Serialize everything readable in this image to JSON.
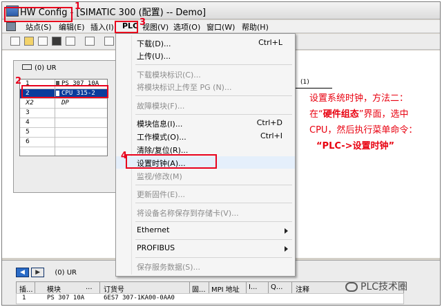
{
  "window": {
    "title": "HW Config - [SIMATIC 300 (配置) -- Demo]"
  },
  "menubar": {
    "items": [
      "站点(S)",
      "编辑(E)",
      "插入(I)",
      "PLC",
      "视图(V)",
      "选项(O)",
      "窗口(W)",
      "帮助(H)"
    ]
  },
  "station": {
    "rack_title": "(0)  UR",
    "rows": [
      {
        "slot": "1",
        "module": "PS 307 10A"
      },
      {
        "slot": "2",
        "module": "CPU 315-2"
      },
      {
        "slot": "X2",
        "module": "DP"
      },
      {
        "slot": "3",
        "module": ""
      },
      {
        "slot": "4",
        "module": ""
      },
      {
        "slot": "5",
        "module": ""
      },
      {
        "slot": "6",
        "module": ""
      }
    ],
    "bus_label": "(1)"
  },
  "plc_menu": {
    "items": [
      {
        "label": "下载(D)...",
        "shortcut": "Ctrl+L",
        "disabled": false
      },
      {
        "label": "上传(U)...",
        "shortcut": "",
        "disabled": false
      },
      {
        "label": "下载模块标识(C)...",
        "shortcut": "",
        "disabled": true
      },
      {
        "label": "将模块标识上传至 PG (N)...",
        "shortcut": "",
        "disabled": true
      },
      {
        "label": "故障模块(F)...",
        "shortcut": "",
        "disabled": true
      },
      {
        "label": "模块信息(I)...",
        "shortcut": "Ctrl+D",
        "disabled": false
      },
      {
        "label": "工作模式(O)...",
        "shortcut": "Ctrl+I",
        "disabled": false
      },
      {
        "label": "清除/复位(R)...",
        "shortcut": "",
        "disabled": false
      },
      {
        "label": "设置时钟(A)...",
        "shortcut": "",
        "disabled": false
      },
      {
        "label": "监视/修改(M)",
        "shortcut": "",
        "disabled": true
      },
      {
        "label": "更新固件(E)...",
        "shortcut": "",
        "disabled": true
      },
      {
        "label": "将设备名称保存到存储卡(V)...",
        "shortcut": "",
        "disabled": true
      },
      {
        "label": "Ethernet",
        "shortcut": "",
        "disabled": false,
        "submenu": true
      },
      {
        "label": "PROFIBUS",
        "shortcut": "",
        "disabled": false,
        "submenu": true
      },
      {
        "label": "保存服务数据(S)...",
        "shortcut": "",
        "disabled": true
      }
    ]
  },
  "annotation": {
    "line1": "设置系统时钟，方法二：",
    "line2a": "在“",
    "line2b": "硬件组态",
    "line2c": "”界面，选中",
    "line3": "CPU，然后执行菜单命令：",
    "line4": "“PLC->设置时钟”",
    "color": "#e8000f"
  },
  "steps": [
    "1",
    "2",
    "3",
    "4"
  ],
  "bottom_pane": {
    "nav_label": "(0)    UR",
    "headers": [
      "插...",
      "模块",
      "...",
      "订货号",
      "固...",
      "MPI 地址",
      "I...",
      "Q...",
      "注释"
    ],
    "row": {
      "slot": "1",
      "module": "PS 307 10A",
      "order": "6ES7 307-1KA00-0AA0"
    }
  },
  "watermark": "PLC技术圈"
}
